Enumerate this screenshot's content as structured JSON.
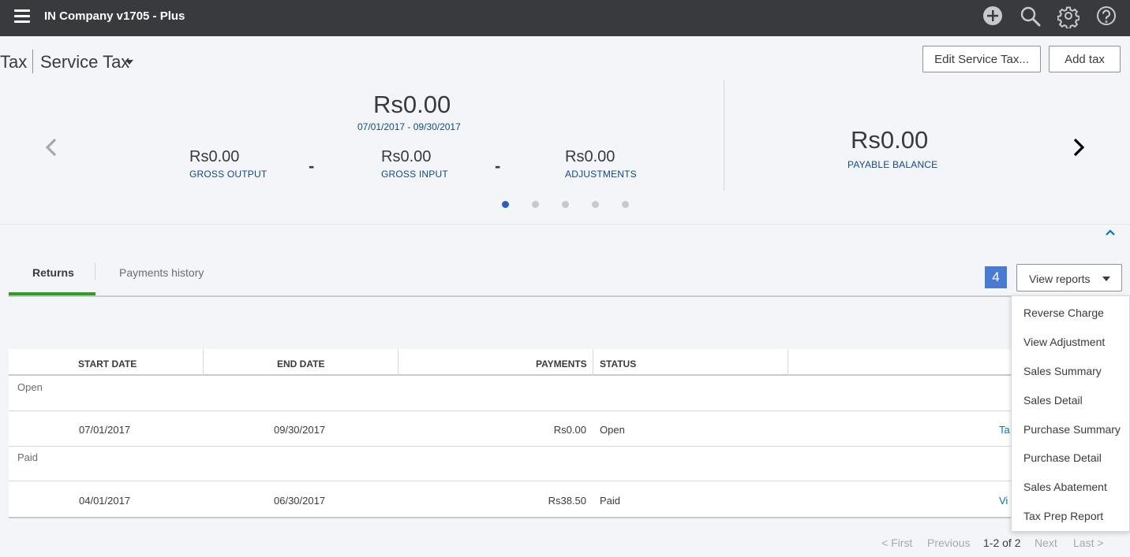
{
  "topbar": {
    "company_name": "IN Company v1705 - Plus",
    "icons": [
      "menu-icon",
      "create-plus-icon",
      "search-icon",
      "gear-icon",
      "help-icon"
    ]
  },
  "header": {
    "title": "Tax",
    "agency": "Service Tax",
    "edit_button": "Edit Service Tax...",
    "add_tax_button": "Add tax"
  },
  "summary": {
    "net_amount": "Rs0.00",
    "period": "07/01/2017 - 09/30/2017",
    "gross_output": {
      "value": "Rs0.00",
      "label": "GROSS OUTPUT"
    },
    "gross_input": {
      "value": "Rs0.00",
      "label": "GROSS INPUT"
    },
    "adjustments": {
      "value": "Rs0.00",
      "label": "ADJUSTMENTS"
    },
    "operator": "-",
    "payable_balance": {
      "value": "Rs0.00",
      "label": "PAYABLE BALANCE"
    },
    "carousel_pages": 5,
    "carousel_active_page": 1
  },
  "tabs": {
    "returns": "Returns",
    "payments_history": "Payments history"
  },
  "badge_label": "4",
  "view_reports": {
    "label": "View reports",
    "items": [
      "Reverse Charge",
      "View Adjustment",
      "Sales Summary",
      "Sales Detail",
      "Purchase Summary",
      "Purchase Detail",
      "Sales Abatement",
      "Tax Prep Report"
    ]
  },
  "table": {
    "columns": {
      "start_date": "START DATE",
      "end_date": "END DATE",
      "payments": "PAYMENTS",
      "status": "STATUS"
    },
    "groups": [
      {
        "label": "Open",
        "rows": [
          {
            "start_date": "07/01/2017",
            "end_date": "09/30/2017",
            "payments": "Rs0.00",
            "status": "Open",
            "action": "Ta:"
          }
        ]
      },
      {
        "label": "Paid",
        "rows": [
          {
            "start_date": "04/01/2017",
            "end_date": "06/30/2017",
            "payments": "Rs38.50",
            "status": "Paid",
            "action": "Vi"
          }
        ]
      }
    ]
  },
  "pagination": {
    "first": "< First",
    "previous": "Previous",
    "range": "1-2 of 2",
    "next": "Next",
    "last": "Last >"
  },
  "colors": {
    "topbar": "#393a3d",
    "link_blue": "#0077c5",
    "label_blue": "#0e4a8a",
    "active_tab": "#2ca01c",
    "active_dot": "#2c5fb8",
    "badge": "#4b7bd1"
  }
}
